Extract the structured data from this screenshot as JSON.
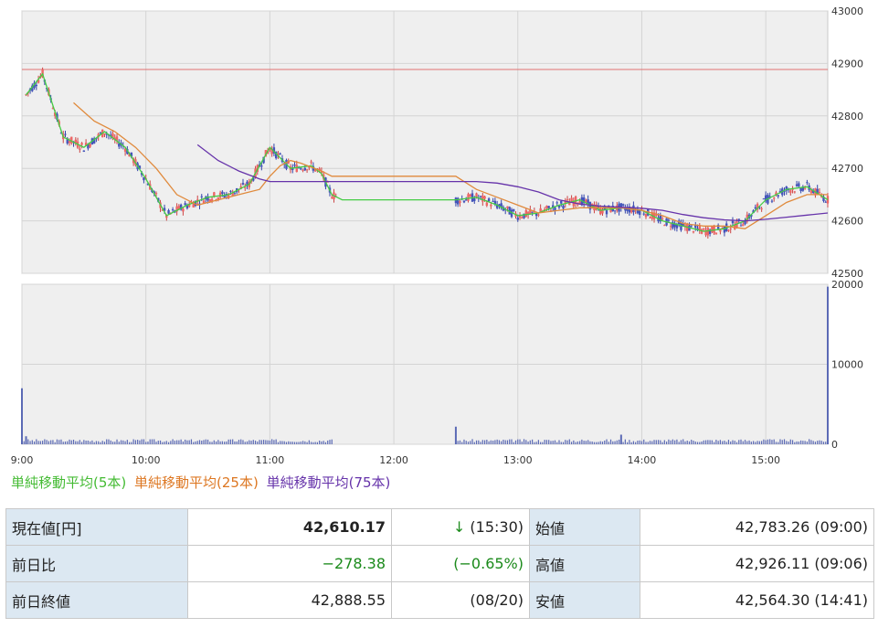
{
  "chart_data": [
    {
      "type": "candlestick",
      "ylim": [
        42500,
        43000
      ],
      "yticks": [
        "43000",
        "42900",
        "42800",
        "42700",
        "42600",
        "42500"
      ],
      "reference_line": 42888.55,
      "series": [
        {
          "name": "単純移動平均(5本)",
          "color": "#44cc44",
          "x": [
            "9:02",
            "9:10",
            "9:20",
            "9:30",
            "9:40",
            "9:50",
            "10:00",
            "10:10",
            "10:20",
            "10:30",
            "10:40",
            "10:50",
            "11:00",
            "11:05",
            "11:10",
            "11:20",
            "11:25",
            "11:30",
            "11:35",
            "11:40",
            "12:30",
            "12:40",
            "12:50",
            "13:00",
            "13:10",
            "13:20",
            "13:30",
            "13:40",
            "13:50",
            "14:00",
            "14:10",
            "14:20",
            "14:30",
            "14:40",
            "14:50",
            "15:00",
            "15:10",
            "15:20",
            "15:30"
          ],
          "values": [
            42840,
            42880,
            42760,
            42740,
            42770,
            42740,
            42680,
            42610,
            42630,
            42645,
            42650,
            42670,
            42740,
            42720,
            42700,
            42705,
            42690,
            42650,
            42640,
            42640,
            42640,
            42645,
            42630,
            42610,
            42615,
            42630,
            42640,
            42620,
            42625,
            42620,
            42600,
            42590,
            42580,
            42585,
            42600,
            42640,
            42660,
            42665,
            42640
          ]
        },
        {
          "name": "単純移動平均(25本)",
          "color": "#e08a3c",
          "x": [
            "9:25",
            "9:35",
            "9:45",
            "9:55",
            "10:05",
            "10:15",
            "10:25",
            "10:35",
            "10:45",
            "10:55",
            "11:00",
            "11:05",
            "11:10",
            "11:15",
            "11:25",
            "11:30",
            "11:40",
            "12:30",
            "12:40",
            "12:50",
            "13:00",
            "13:10",
            "13:20",
            "13:30",
            "13:40",
            "13:50",
            "14:00",
            "14:10",
            "14:20",
            "14:30",
            "14:40",
            "14:50",
            "15:00",
            "15:10",
            "15:20",
            "15:30"
          ],
          "values": [
            42825,
            42790,
            42770,
            42740,
            42700,
            42650,
            42630,
            42640,
            42650,
            42660,
            42685,
            42705,
            42715,
            42710,
            42695,
            42685,
            42685,
            42685,
            42660,
            42645,
            42630,
            42615,
            42620,
            42625,
            42625,
            42625,
            42620,
            42610,
            42595,
            42590,
            42590,
            42585,
            42610,
            42635,
            42650,
            42650
          ]
        },
        {
          "name": "単純移動平均(75本)",
          "color": "#6633aa",
          "x": [
            "10:25",
            "10:35",
            "10:45",
            "10:55",
            "11:00",
            "11:10",
            "11:20",
            "11:30",
            "11:40",
            "12:30",
            "12:40",
            "12:50",
            "13:00",
            "13:10",
            "13:20",
            "13:30",
            "13:40",
            "13:50",
            "14:00",
            "14:10",
            "14:20",
            "14:30",
            "14:40",
            "14:50",
            "15:00",
            "15:10",
            "15:20",
            "15:30"
          ],
          "values": [
            42745,
            42715,
            42695,
            42680,
            42675,
            42675,
            42675,
            42675,
            42675,
            42675,
            42675,
            42672,
            42665,
            42655,
            42640,
            42632,
            42628,
            42626,
            42624,
            42620,
            42612,
            42606,
            42602,
            42600,
            42603,
            42607,
            42611,
            42615
          ]
        }
      ]
    },
    {
      "type": "bar",
      "ylim": [
        0,
        20000
      ],
      "yticks": [
        "20000",
        "10000",
        "0"
      ],
      "x": [
        "9:00",
        "9:02",
        "12:30",
        "13:50",
        "15:30"
      ],
      "values": [
        7000,
        1000,
        2200,
        1200,
        19700
      ],
      "color": "#5b6ab5"
    }
  ],
  "xticks": [
    "9:00",
    "10:00",
    "11:00",
    "12:00",
    "13:00",
    "14:00",
    "15:00"
  ],
  "legend": {
    "ma5": "単純移動平均(5本)",
    "ma25": "単純移動平均(25本)",
    "ma75": "単純移動平均(75本)"
  },
  "colors": {
    "ma5": "#44bb33",
    "ma25": "#dd7722",
    "ma75": "#6633aa",
    "reference": "#e07070"
  },
  "table": {
    "current_label": "現在値[円]",
    "current_value": "42,610.17",
    "current_arrow": "↓",
    "current_time": "(15:30)",
    "open_label": "始値",
    "open_value": "42,783.26 (09:00)",
    "change_label": "前日比",
    "change_value": "−278.38",
    "change_pct": "(−0.65%)",
    "high_label": "高値",
    "high_value": "42,926.11 (09:06)",
    "prev_close_label": "前日終値",
    "prev_close_value": "42,888.55",
    "prev_close_date": "(08/20)",
    "low_label": "安値",
    "low_value": "42,564.30 (14:41)"
  }
}
